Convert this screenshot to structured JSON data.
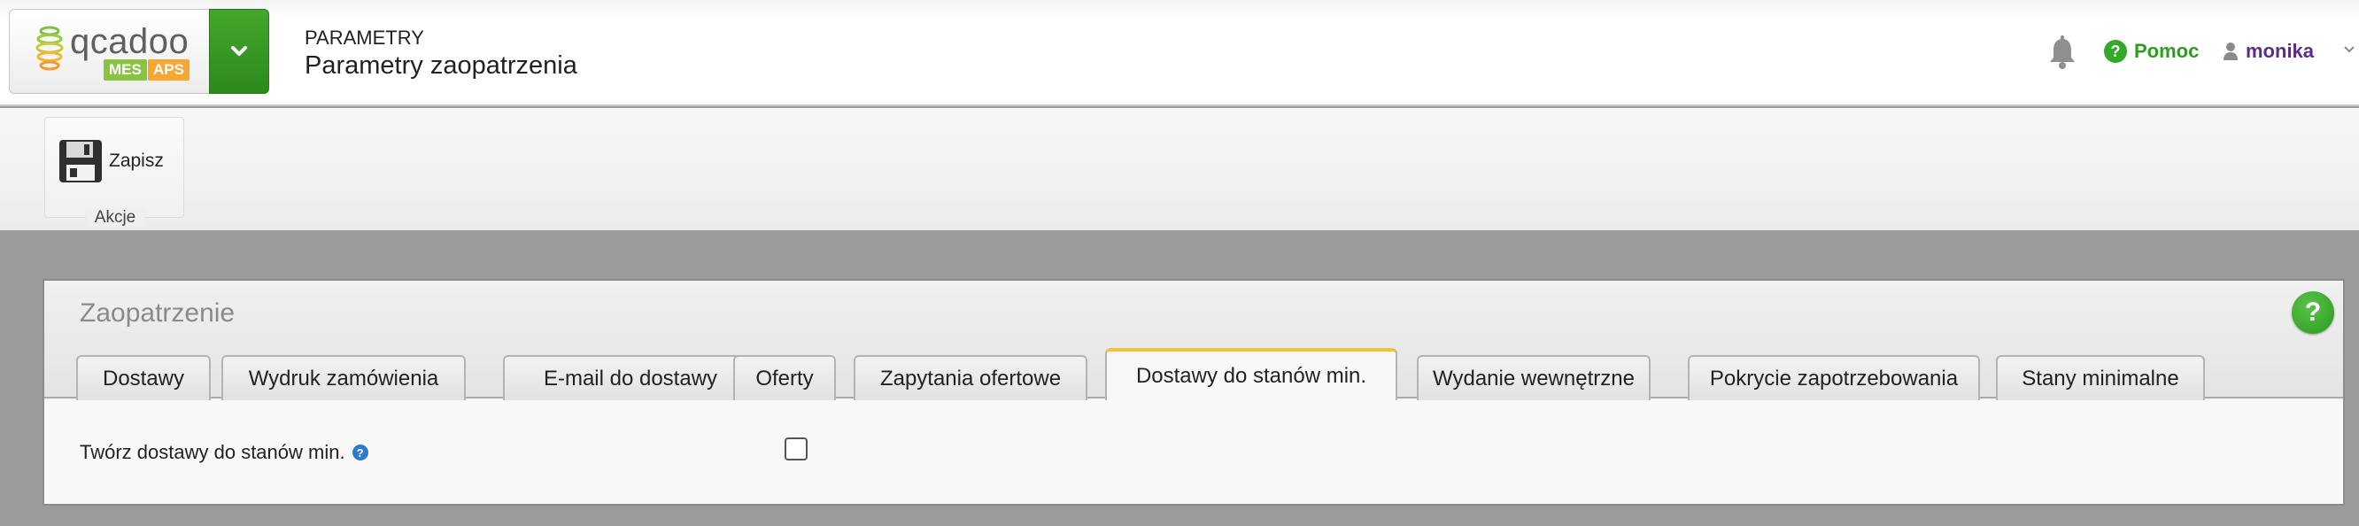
{
  "app": {
    "logo_text": "qcadoo",
    "badge_mes": "MES",
    "badge_aps": "APS",
    "section": "PARAMETRY",
    "title": "Parametry zaopatrzenia"
  },
  "header": {
    "help_label": "Pomoc",
    "help_icon": "?",
    "user_name": "monika",
    "accent_green": "#2d9c1f",
    "user_color": "#5b2d8a"
  },
  "toolbar": {
    "save_label": "Zapisz",
    "group_label": "Akcje"
  },
  "panel": {
    "title": "Zaopatrzenie",
    "help_icon": "?",
    "tabs": [
      {
        "label": "Dostawy"
      },
      {
        "label": "Wydruk zamówienia"
      },
      {
        "label": "E-mail do dostawy"
      },
      {
        "label": "Oferty"
      },
      {
        "label": "Zapytania ofertowe"
      },
      {
        "label": "Dostawy do stanów min.",
        "active": true
      },
      {
        "label": "Wydanie wewnętrzne"
      },
      {
        "label": "Pokrycie zapotrzebowania"
      },
      {
        "label": "Stany minimalne"
      }
    ],
    "field": {
      "label": "Twórz dostawy do stanów min.",
      "info_icon": "?",
      "checked": false
    },
    "active_tab_color": "#f2c23d"
  }
}
